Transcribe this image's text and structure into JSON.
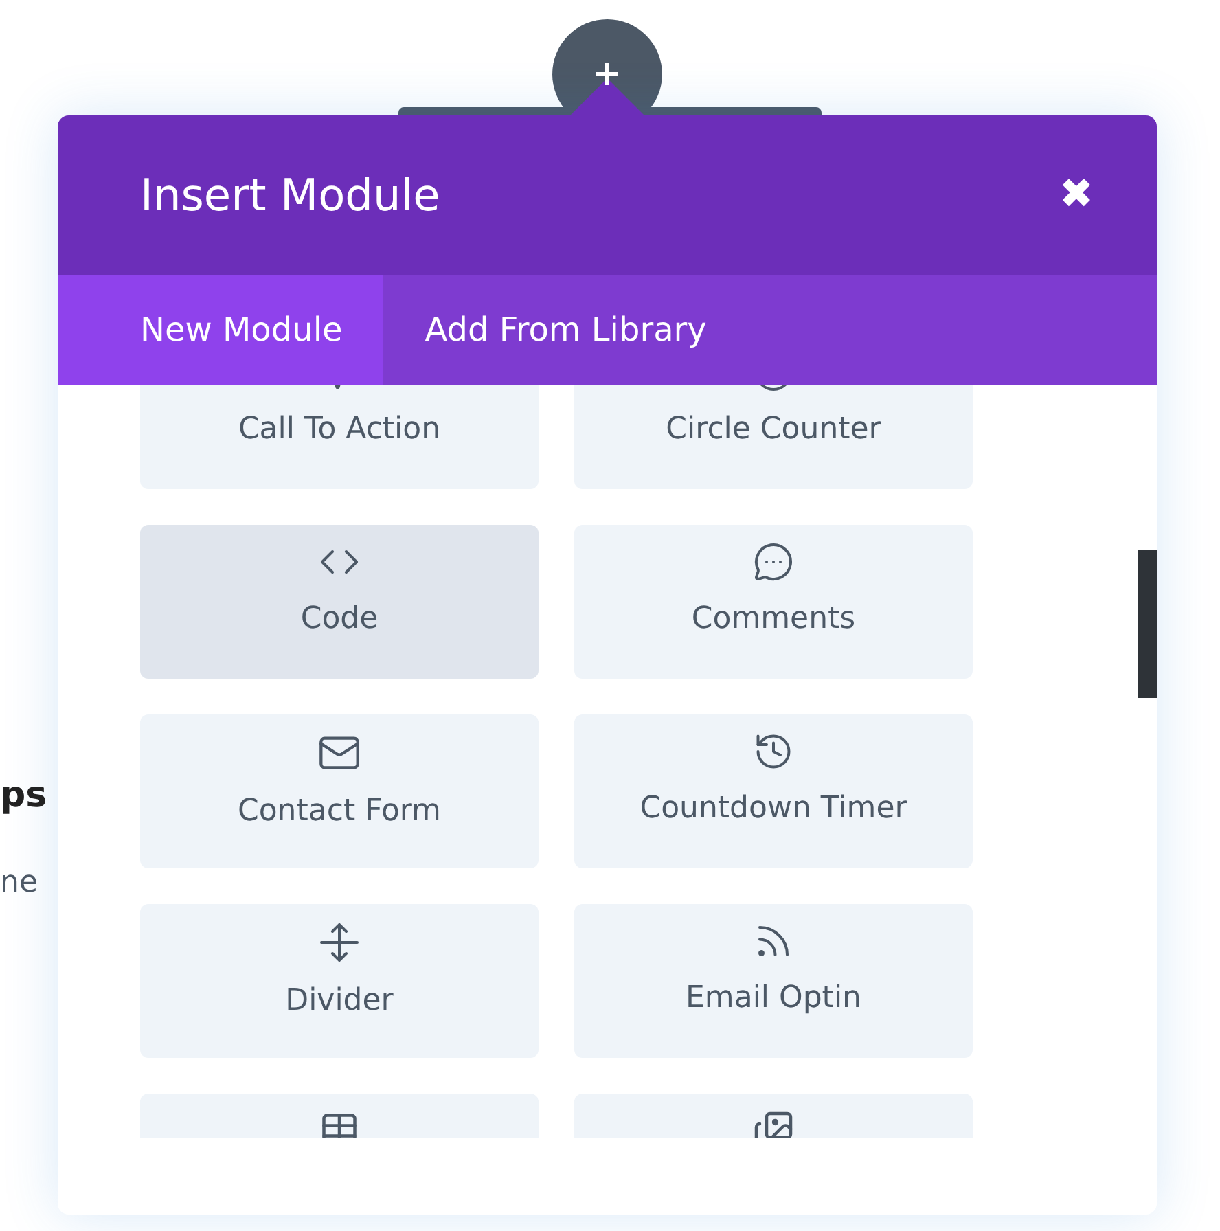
{
  "background_text": [
    "ps",
    "ne"
  ],
  "modal": {
    "title": "Insert Module",
    "close": "✖",
    "tabs": [
      {
        "label": "New Module",
        "selected": true
      },
      {
        "label": "Add From Library",
        "selected": false
      }
    ],
    "modules": [
      {
        "label": "Call To Action",
        "selected": false
      },
      {
        "label": "Circle Counter",
        "selected": false
      },
      {
        "label": "Code",
        "selected": true
      },
      {
        "label": "Comments",
        "selected": false
      },
      {
        "label": "Contact Form",
        "selected": false
      },
      {
        "label": "Countdown Timer",
        "selected": false
      },
      {
        "label": "Divider",
        "selected": false
      },
      {
        "label": "Email Optin",
        "selected": false
      },
      {
        "selected": false
      },
      {
        "selected": false
      }
    ]
  }
}
